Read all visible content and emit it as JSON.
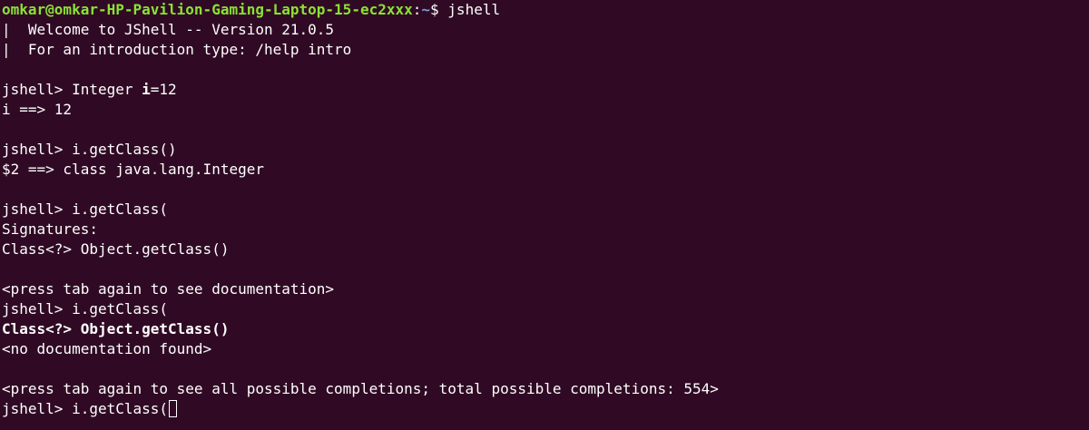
{
  "shell_prompt": {
    "user_host": "omkar@omkar-HP-Pavilion-Gaming-Laptop-15-ec2xxx",
    "separator": ":",
    "path": "~",
    "symbol": "$ ",
    "command": "jshell"
  },
  "banner": [
    "|  Welcome to JShell -- Version 21.0.5",
    "|  For an introduction type: /help intro"
  ],
  "session": {
    "prompt": "jshell> ",
    "decl_cmd_prefix": "Integer ",
    "decl_cmd_var": "i",
    "decl_cmd_suffix": "=12",
    "decl_result": "i ==> 12",
    "getclass_cmd": "i.getClass()",
    "getclass_result": "$2 ==> class java.lang.Integer",
    "partial_cmd": "i.getClass(",
    "signatures_label": "Signatures:",
    "signature": "Class<?> Object.getClass()",
    "hint_doc": "<press tab again to see documentation>",
    "doc_signature": "Class<?> Object.getClass()",
    "doc_result": "<no documentation found>",
    "hint_completions": "<press tab again to see all possible completions; total possible completions: 554>",
    "current_input": "i.getClass("
  },
  "colors": {
    "background": "#300a24",
    "text": "#ffffff",
    "prompt_user": "#8ae234",
    "prompt_path": "#729fcf"
  }
}
